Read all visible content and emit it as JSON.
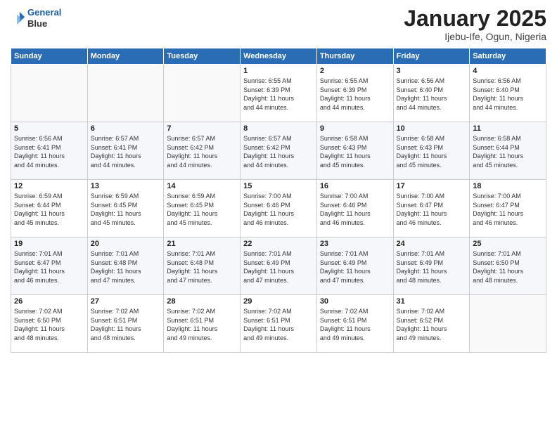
{
  "header": {
    "logo_line1": "General",
    "logo_line2": "Blue",
    "month": "January 2025",
    "location": "Ijebu-Ife, Ogun, Nigeria"
  },
  "weekdays": [
    "Sunday",
    "Monday",
    "Tuesday",
    "Wednesday",
    "Thursday",
    "Friday",
    "Saturday"
  ],
  "weeks": [
    [
      {
        "day": "",
        "info": ""
      },
      {
        "day": "",
        "info": ""
      },
      {
        "day": "",
        "info": ""
      },
      {
        "day": "1",
        "info": "Sunrise: 6:55 AM\nSunset: 6:39 PM\nDaylight: 11 hours\nand 44 minutes."
      },
      {
        "day": "2",
        "info": "Sunrise: 6:55 AM\nSunset: 6:39 PM\nDaylight: 11 hours\nand 44 minutes."
      },
      {
        "day": "3",
        "info": "Sunrise: 6:56 AM\nSunset: 6:40 PM\nDaylight: 11 hours\nand 44 minutes."
      },
      {
        "day": "4",
        "info": "Sunrise: 6:56 AM\nSunset: 6:40 PM\nDaylight: 11 hours\nand 44 minutes."
      }
    ],
    [
      {
        "day": "5",
        "info": "Sunrise: 6:56 AM\nSunset: 6:41 PM\nDaylight: 11 hours\nand 44 minutes."
      },
      {
        "day": "6",
        "info": "Sunrise: 6:57 AM\nSunset: 6:41 PM\nDaylight: 11 hours\nand 44 minutes."
      },
      {
        "day": "7",
        "info": "Sunrise: 6:57 AM\nSunset: 6:42 PM\nDaylight: 11 hours\nand 44 minutes."
      },
      {
        "day": "8",
        "info": "Sunrise: 6:57 AM\nSunset: 6:42 PM\nDaylight: 11 hours\nand 44 minutes."
      },
      {
        "day": "9",
        "info": "Sunrise: 6:58 AM\nSunset: 6:43 PM\nDaylight: 11 hours\nand 45 minutes."
      },
      {
        "day": "10",
        "info": "Sunrise: 6:58 AM\nSunset: 6:43 PM\nDaylight: 11 hours\nand 45 minutes."
      },
      {
        "day": "11",
        "info": "Sunrise: 6:58 AM\nSunset: 6:44 PM\nDaylight: 11 hours\nand 45 minutes."
      }
    ],
    [
      {
        "day": "12",
        "info": "Sunrise: 6:59 AM\nSunset: 6:44 PM\nDaylight: 11 hours\nand 45 minutes."
      },
      {
        "day": "13",
        "info": "Sunrise: 6:59 AM\nSunset: 6:45 PM\nDaylight: 11 hours\nand 45 minutes."
      },
      {
        "day": "14",
        "info": "Sunrise: 6:59 AM\nSunset: 6:45 PM\nDaylight: 11 hours\nand 45 minutes."
      },
      {
        "day": "15",
        "info": "Sunrise: 7:00 AM\nSunset: 6:46 PM\nDaylight: 11 hours\nand 46 minutes."
      },
      {
        "day": "16",
        "info": "Sunrise: 7:00 AM\nSunset: 6:46 PM\nDaylight: 11 hours\nand 46 minutes."
      },
      {
        "day": "17",
        "info": "Sunrise: 7:00 AM\nSunset: 6:47 PM\nDaylight: 11 hours\nand 46 minutes."
      },
      {
        "day": "18",
        "info": "Sunrise: 7:00 AM\nSunset: 6:47 PM\nDaylight: 11 hours\nand 46 minutes."
      }
    ],
    [
      {
        "day": "19",
        "info": "Sunrise: 7:01 AM\nSunset: 6:47 PM\nDaylight: 11 hours\nand 46 minutes."
      },
      {
        "day": "20",
        "info": "Sunrise: 7:01 AM\nSunset: 6:48 PM\nDaylight: 11 hours\nand 47 minutes."
      },
      {
        "day": "21",
        "info": "Sunrise: 7:01 AM\nSunset: 6:48 PM\nDaylight: 11 hours\nand 47 minutes."
      },
      {
        "day": "22",
        "info": "Sunrise: 7:01 AM\nSunset: 6:49 PM\nDaylight: 11 hours\nand 47 minutes."
      },
      {
        "day": "23",
        "info": "Sunrise: 7:01 AM\nSunset: 6:49 PM\nDaylight: 11 hours\nand 47 minutes."
      },
      {
        "day": "24",
        "info": "Sunrise: 7:01 AM\nSunset: 6:49 PM\nDaylight: 11 hours\nand 48 minutes."
      },
      {
        "day": "25",
        "info": "Sunrise: 7:01 AM\nSunset: 6:50 PM\nDaylight: 11 hours\nand 48 minutes."
      }
    ],
    [
      {
        "day": "26",
        "info": "Sunrise: 7:02 AM\nSunset: 6:50 PM\nDaylight: 11 hours\nand 48 minutes."
      },
      {
        "day": "27",
        "info": "Sunrise: 7:02 AM\nSunset: 6:51 PM\nDaylight: 11 hours\nand 48 minutes."
      },
      {
        "day": "28",
        "info": "Sunrise: 7:02 AM\nSunset: 6:51 PM\nDaylight: 11 hours\nand 49 minutes."
      },
      {
        "day": "29",
        "info": "Sunrise: 7:02 AM\nSunset: 6:51 PM\nDaylight: 11 hours\nand 49 minutes."
      },
      {
        "day": "30",
        "info": "Sunrise: 7:02 AM\nSunset: 6:51 PM\nDaylight: 11 hours\nand 49 minutes."
      },
      {
        "day": "31",
        "info": "Sunrise: 7:02 AM\nSunset: 6:52 PM\nDaylight: 11 hours\nand 49 minutes."
      },
      {
        "day": "",
        "info": ""
      }
    ]
  ]
}
